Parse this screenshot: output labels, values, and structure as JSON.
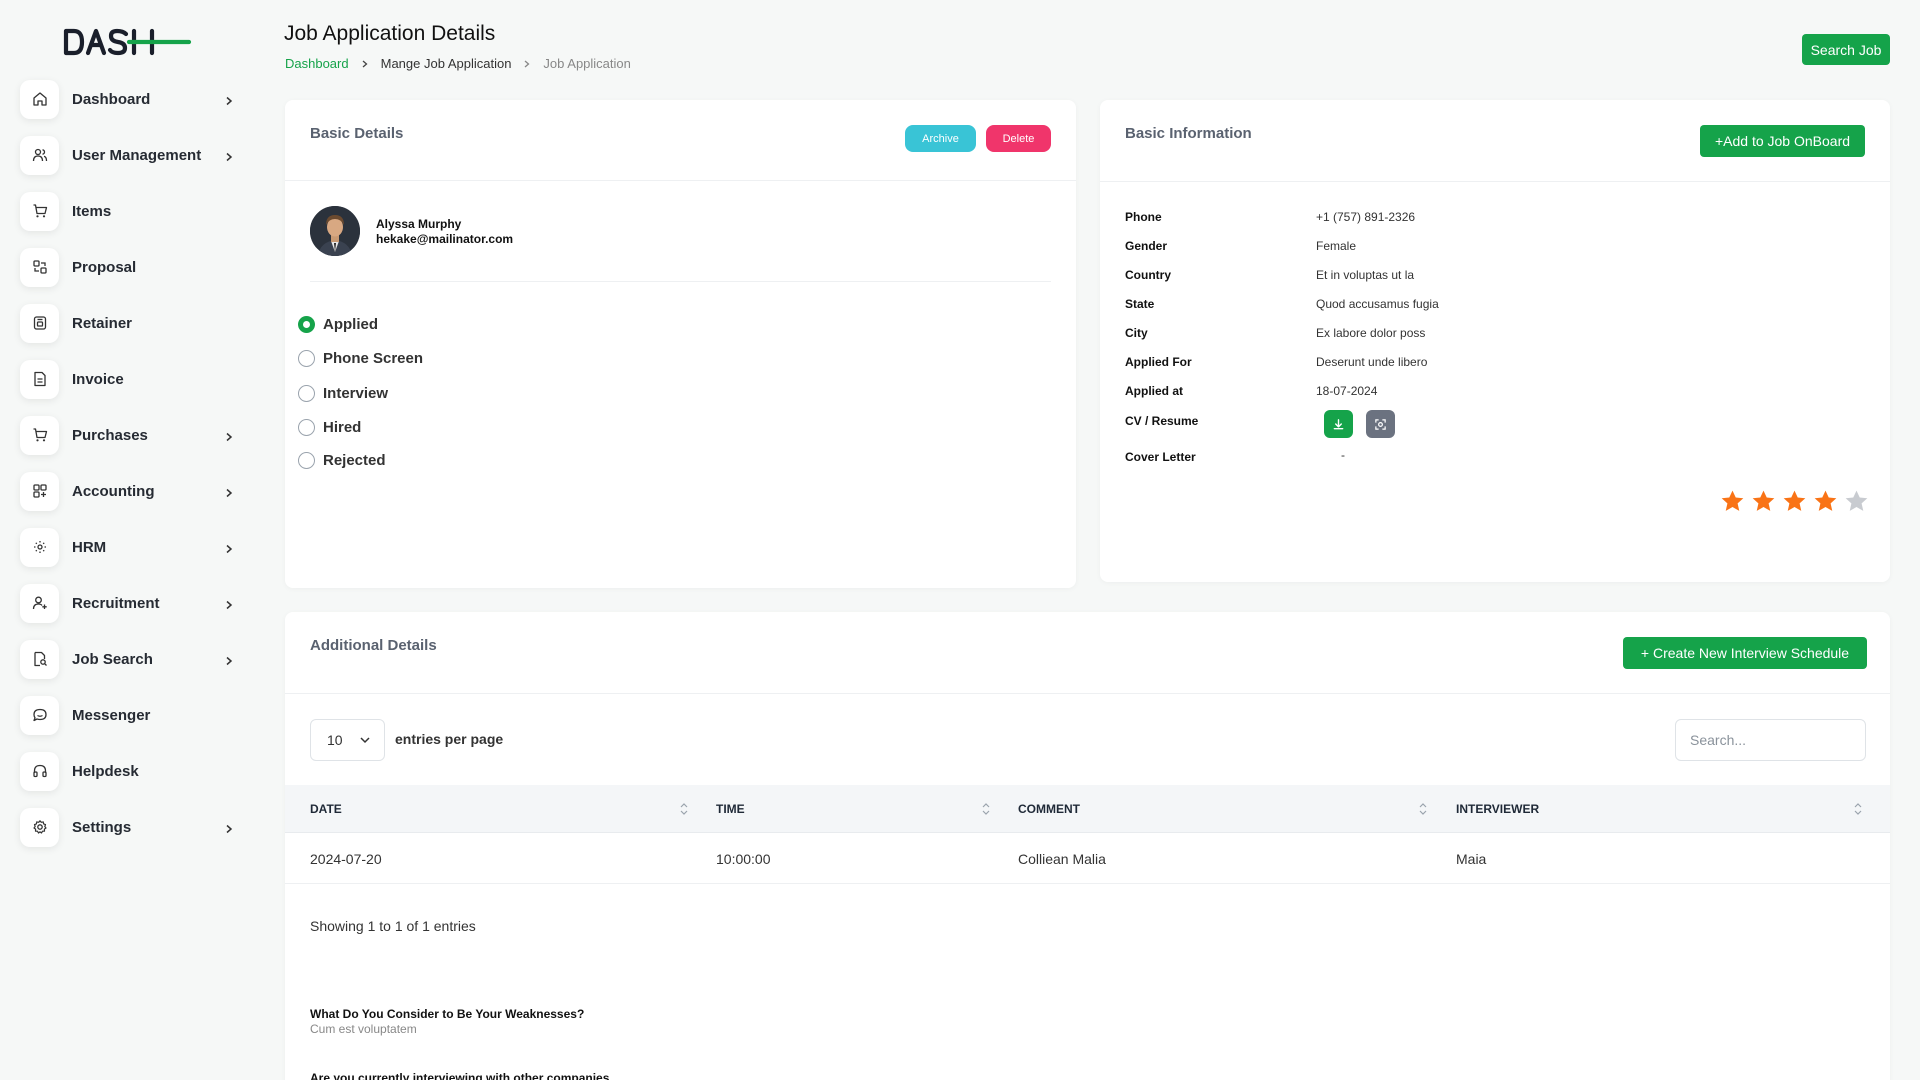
{
  "brand": {
    "logo_text": "DASH",
    "accent": "#15a34a"
  },
  "sidebar": {
    "items": [
      {
        "label": "Dashboard",
        "icon": "home-icon",
        "has_chevron": true
      },
      {
        "label": "User Management",
        "icon": "users-icon",
        "has_chevron": true
      },
      {
        "label": "Items",
        "icon": "cart-icon",
        "has_chevron": false
      },
      {
        "label": "Proposal",
        "icon": "proposal-icon",
        "has_chevron": false
      },
      {
        "label": "Retainer",
        "icon": "retainer-icon",
        "has_chevron": false
      },
      {
        "label": "Invoice",
        "icon": "invoice-icon",
        "has_chevron": false
      },
      {
        "label": "Purchases",
        "icon": "cart-icon",
        "has_chevron": true
      },
      {
        "label": "Accounting",
        "icon": "grid-icon",
        "has_chevron": true
      },
      {
        "label": "HRM",
        "icon": "hrm-icon",
        "has_chevron": true
      },
      {
        "label": "Recruitment",
        "icon": "user-plus-icon",
        "has_chevron": true
      },
      {
        "label": "Job Search",
        "icon": "file-search-icon",
        "has_chevron": true
      },
      {
        "label": "Messenger",
        "icon": "message-icon",
        "has_chevron": false
      },
      {
        "label": "Helpdesk",
        "icon": "headset-icon",
        "has_chevron": false
      },
      {
        "label": "Settings",
        "icon": "gear-icon",
        "has_chevron": true
      }
    ]
  },
  "header": {
    "title": "Job Application Details",
    "breadcrumb": [
      "Dashboard",
      "Mange Job Application",
      "Job Application"
    ],
    "search_job_label": "Search Job"
  },
  "basic_details": {
    "title": "Basic Details",
    "archive_label": "Archive",
    "delete_label": "Delete",
    "applicant": {
      "name": "Alyssa Murphy",
      "email": "hekake@mailinator.com"
    },
    "stages": [
      {
        "label": "Applied",
        "checked": true
      },
      {
        "label": "Phone Screen",
        "checked": false
      },
      {
        "label": "Interview",
        "checked": false
      },
      {
        "label": "Hired",
        "checked": false
      },
      {
        "label": "Rejected",
        "checked": false
      }
    ]
  },
  "basic_info": {
    "title": "Basic Information",
    "onboard_label": "Add to Job OnBoard",
    "rows": [
      {
        "label": "Phone",
        "value": "+1 (757) 891-2326"
      },
      {
        "label": "Gender",
        "value": "Female"
      },
      {
        "label": "Country",
        "value": "Et in voluptas ut la"
      },
      {
        "label": "State",
        "value": "Quod accusamus fugia"
      },
      {
        "label": "City",
        "value": "Ex labore dolor poss"
      },
      {
        "label": "Applied For",
        "value": "Deserunt unde libero"
      },
      {
        "label": "Applied at",
        "value": "18-07-2024"
      }
    ],
    "cv_label": "CV / Resume",
    "cover_label": "Cover Letter",
    "cover_value": "-",
    "rating": 4,
    "rating_max": 5
  },
  "additional": {
    "title": "Additional Details",
    "create_label": "Create New Interview Schedule",
    "entries_value": "10",
    "entries_label": "entries per page",
    "search_placeholder": "Search...",
    "columns": [
      "DATE",
      "TIME",
      "COMMENT",
      "INTERVIEWER"
    ],
    "rows": [
      [
        "2024-07-20",
        "10:00:00",
        "Colliean Malia",
        "Maia"
      ]
    ],
    "showing": "Showing 1 to 1 of 1 entries",
    "questions": [
      {
        "q": "What Do You Consider to Be Your Weaknesses?",
        "a": "Cum est voluptatem"
      },
      {
        "q": "Are you currently interviewing with other companies",
        "a": ""
      }
    ]
  }
}
